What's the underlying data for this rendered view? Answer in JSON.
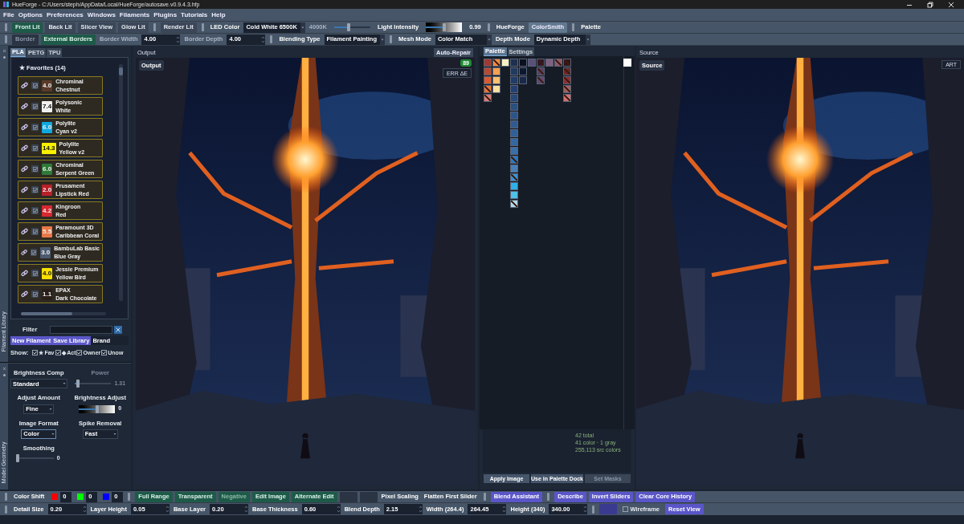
{
  "window": {
    "title": "HueForge - C:/Users/steph/AppData/Local/HueForge/autosave.v0.9.4.3.hfp"
  },
  "menu": [
    "File",
    "Options",
    "Preferences",
    "Windows",
    "Filaments",
    "Plugins",
    "Tutorials",
    "Help"
  ],
  "toolbars": [
    [
      {
        "kind": "sep"
      },
      {
        "kind": "green_button",
        "label": "Front Lit"
      },
      {
        "kind": "button",
        "label": "Back Lit"
      },
      {
        "kind": "button",
        "label": "Slicer View"
      },
      {
        "kind": "button",
        "label": "Glow Lit"
      },
      {
        "kind": "sep"
      },
      {
        "kind": "button",
        "label": "Render Lit"
      },
      {
        "kind": "sep"
      },
      {
        "kind": "label",
        "label": "LED Color"
      },
      {
        "kind": "select",
        "value": "Cold White 6500K"
      },
      {
        "kind": "label",
        "label": "4000K",
        "disabled": true
      },
      {
        "kind": "slider",
        "level": 0.4
      },
      {
        "kind": "label",
        "label": "Light Intensity"
      },
      {
        "kind": "gradient_slider",
        "level": 0.5
      },
      {
        "kind": "label",
        "label": "0.99"
      },
      {
        "kind": "sep"
      },
      {
        "kind": "label",
        "label": "HueForge"
      },
      {
        "kind": "light_button",
        "label": "ColorSmith"
      },
      {
        "kind": "sep"
      },
      {
        "kind": "label",
        "label": "Palette"
      }
    ],
    [
      {
        "kind": "sep"
      },
      {
        "kind": "button",
        "label": "Border",
        "disabled": true
      },
      {
        "kind": "green_button",
        "label": "External Borders"
      },
      {
        "kind": "label",
        "label": "Border Width",
        "disabled": true
      },
      {
        "kind": "spin",
        "value": "4.00"
      },
      {
        "kind": "label",
        "label": "Border Depth",
        "disabled": true
      },
      {
        "kind": "spin",
        "value": "4.00"
      },
      {
        "kind": "sep"
      },
      {
        "kind": "label",
        "label": "Blending Type"
      },
      {
        "kind": "select",
        "value": "Filament Painting"
      },
      {
        "kind": "sep"
      },
      {
        "kind": "label",
        "label": "Mesh Mode"
      },
      {
        "kind": "select",
        "value": "Color Match"
      },
      {
        "kind": "label",
        "label": "Depth Mode"
      },
      {
        "kind": "select",
        "value": "Dynamic Depth"
      }
    ]
  ],
  "filament_library": {
    "dock_label": "Filament Library",
    "tabs": [
      {
        "label": "PLA",
        "selected": true
      },
      {
        "label": "PETG",
        "selected": false
      },
      {
        "label": "TPU",
        "selected": false
      }
    ],
    "favorites_label": "★ Favorites (14)",
    "filaments": [
      {
        "value": "4.0",
        "brand": "Chrominal",
        "name": "Chestnut",
        "color": "#5a3a2a",
        "checked": true
      },
      {
        "value": "7.4",
        "brand": "Polysonic",
        "name": "White",
        "color": "#f0f0f0",
        "checked": true
      },
      {
        "value": "6.0",
        "brand": "Polylite",
        "name": "Cyan v2",
        "color": "#10a8e0",
        "checked": true
      },
      {
        "value": "14.3",
        "brand": "Polylite",
        "name": "Yellow v2",
        "color": "#f8f000",
        "checked": true
      },
      {
        "value": "6.0",
        "brand": "Chrominal",
        "name": "Serpent Green",
        "color": "#2e7a38",
        "checked": true
      },
      {
        "value": "2.0",
        "brand": "Prusament",
        "name": "Lipstick Red",
        "color": "#b8202a",
        "checked": true
      },
      {
        "value": "4.2",
        "brand": "Kingroon",
        "name": "Red",
        "color": "#d82830",
        "checked": true
      },
      {
        "value": "5.5",
        "brand": "Paramount 3D",
        "name": "Caribbean Coral",
        "color": "#e87848",
        "checked": true
      },
      {
        "value": "3.0",
        "brand": "BambuLab Basic",
        "name": "Blue Gray",
        "color": "#4a5a70",
        "checked": true
      },
      {
        "value": "4.0",
        "brand": "Jessie Premium",
        "name": "Yellow Bird",
        "color": "#f8e000",
        "checked": true
      },
      {
        "value": "1.1",
        "brand": "EPAX",
        "name": "Dark Chocolate",
        "color": "#2a1e1a",
        "checked": true
      }
    ],
    "filter_label": "Filter",
    "buttons": [
      "New Filament",
      "Save Library"
    ],
    "brand_label": "Brand",
    "show_label": "Show:",
    "show_options": [
      {
        "label": "★ Fav",
        "checked": true
      },
      {
        "label": "◆ Act",
        "checked": true
      },
      {
        "label": "Owner",
        "checked": true
      },
      {
        "label": "Unow",
        "checked": true
      }
    ]
  },
  "model_geometry": {
    "dock_label": "Model Geometry",
    "brightness_comp": {
      "label": "Brightness Comp",
      "value": "Standard"
    },
    "power": {
      "label": "Power",
      "level": 0.08,
      "reading": "1.31"
    },
    "adjust_amount": {
      "label": "Adjust Amount",
      "value": "Fine"
    },
    "brightness_adjust": {
      "label": "Brightness Adjust",
      "level": 0.5,
      "reading": "0"
    },
    "image_format": {
      "label": "Image Format",
      "value": "Color"
    },
    "spike_removal": {
      "label": "Spike Removal",
      "value": "Fast"
    },
    "smoothing": {
      "label": "Smoothing",
      "level": 0,
      "reading": "0"
    }
  },
  "output": {
    "title": "Output",
    "button": "Auto-Repair",
    "tag": "Output",
    "score": "89",
    "err_button": "ERR ΔE"
  },
  "palette": {
    "tabs": [
      {
        "label": "Palette",
        "selected": true
      },
      {
        "label": "Settings",
        "selected": false
      }
    ],
    "columns": [
      [
        {
          "color": "#a03a30",
          "hatched": false
        },
        {
          "color": "#b84a30",
          "hatched": false
        },
        {
          "color": "#d85a30",
          "hatched": false
        },
        {
          "color": "#e87030",
          "hatched": true
        },
        {
          "color": "#d87a70",
          "hatched": true
        }
      ],
      [
        {
          "color": "#f08a40",
          "hatched": true
        },
        {
          "color": "#f8a050",
          "hatched": false
        },
        {
          "color": "#f8c070",
          "hatched": false
        },
        {
          "color": "#f8e0a0",
          "hatched": false
        }
      ],
      [
        {
          "color": "#f8f0c0",
          "hatched": false
        }
      ],
      [
        {
          "color": "#1e3050",
          "hatched": false
        },
        {
          "color": "#203a60",
          "hatched": false
        },
        {
          "color": "#203c68",
          "hatched": false
        },
        {
          "color": "#244070",
          "hatched": false
        },
        {
          "color": "#284878",
          "hatched": false
        },
        {
          "color": "#2a5080",
          "hatched": false
        },
        {
          "color": "#2c5488",
          "hatched": false
        },
        {
          "color": "#305a90",
          "hatched": false
        },
        {
          "color": "#306098",
          "hatched": false
        },
        {
          "color": "#3468a0",
          "hatched": false
        },
        {
          "color": "#3a70a8",
          "hatched": false
        },
        {
          "color": "#2a78c0",
          "hatched": true
        },
        {
          "color": "#4a80b8",
          "hatched": false
        },
        {
          "color": "#3a90d0",
          "hatched": true
        },
        {
          "color": "#30b0e8",
          "hatched": false
        },
        {
          "color": "#50c0e8",
          "hatched": false
        },
        {
          "color": "#b0d8e8",
          "hatched": true
        }
      ],
      [
        {
          "color": "#0a1020",
          "hatched": false
        },
        {
          "color": "#0c1830",
          "hatched": false
        },
        {
          "color": "#1a2848",
          "hatched": false
        }
      ],
      [
        {
          "color": "#5a5078",
          "hatched": false
        }
      ],
      [
        {
          "color": "#301828",
          "hatched": true
        },
        {
          "color": "#584060",
          "hatched": true
        },
        {
          "color": "#604870",
          "hatched": true
        }
      ],
      [
        {
          "color": "#806080",
          "hatched": false
        }
      ],
      [
        {
          "color": "#905868",
          "hatched": true
        }
      ],
      [
        {
          "color": "#301418",
          "hatched": true
        },
        {
          "color": "#6a2828",
          "hatched": true
        },
        {
          "color": "#8a3030",
          "hatched": true
        },
        {
          "color": "#a06060",
          "hatched": true
        },
        {
          "color": "#d07070",
          "hatched": true
        }
      ]
    ],
    "side_swatch": {
      "color": "#ffffff"
    },
    "stats": [
      "42 total",
      "41 color · 1 gray",
      "255,113 src colors"
    ],
    "buttons": [
      {
        "label": "Apply Image",
        "disabled": false
      },
      {
        "label": "Use in Palette Dock",
        "disabled": false
      },
      {
        "label": "Set Masks",
        "disabled": true
      }
    ]
  },
  "source": {
    "title": "Source",
    "tag": "Source",
    "button": "ART"
  },
  "bottom_bars": [
    [
      {
        "kind": "sep"
      },
      {
        "kind": "label",
        "label": "Color Shift"
      },
      {
        "kind": "color",
        "color": "#ff0000"
      },
      {
        "kind": "spin",
        "value": "0"
      },
      {
        "kind": "color",
        "color": "#00ff00"
      },
      {
        "kind": "spin",
        "value": "0"
      },
      {
        "kind": "color",
        "color": "#0000ff"
      },
      {
        "kind": "spin",
        "value": "0"
      },
      {
        "kind": "sep"
      },
      {
        "kind": "green_button",
        "label": "Full Range"
      },
      {
        "kind": "green_button",
        "label": "Transparent"
      },
      {
        "kind": "green_button",
        "label": "Negative",
        "disabled": true
      },
      {
        "kind": "green_button",
        "label": "Edit Image"
      },
      {
        "kind": "green_button",
        "label": "Alternate Edit"
      },
      {
        "kind": "button",
        "disabled": true
      },
      {
        "kind": "button",
        "disabled": true
      },
      {
        "kind": "label",
        "label": "Pixel Scaling"
      },
      {
        "kind": "label",
        "label": "Flatten First Slider"
      },
      {
        "kind": "sep"
      },
      {
        "kind": "purple_button",
        "label": "Blend Assistant"
      },
      {
        "kind": "sep"
      },
      {
        "kind": "purple_button",
        "label": "Describe"
      },
      {
        "kind": "purple_button",
        "label": "Invert Sliders"
      },
      {
        "kind": "purple_button",
        "label": "Clear Core History"
      }
    ],
    [
      {
        "kind": "sep"
      },
      {
        "kind": "label",
        "label": "Detail Size"
      },
      {
        "kind": "spin",
        "value": "0.20"
      },
      {
        "kind": "label",
        "label": "Layer Height"
      },
      {
        "kind": "spin",
        "value": "0.05"
      },
      {
        "kind": "label",
        "label": "Base Layer"
      },
      {
        "kind": "spin",
        "value": "0.20"
      },
      {
        "kind": "label",
        "label": "Base Thickness"
      },
      {
        "kind": "spin",
        "value": "0.60"
      },
      {
        "kind": "label",
        "label": "Blend Depth"
      },
      {
        "kind": "spin",
        "value": "2.15"
      },
      {
        "kind": "label",
        "label": "Width (264.4)"
      },
      {
        "kind": "spin",
        "value": "264.45"
      },
      {
        "kind": "label",
        "label": "Height (340)"
      },
      {
        "kind": "spin",
        "value": "340.00"
      },
      {
        "kind": "sep"
      },
      {
        "kind": "purple_button",
        "disabled": true
      },
      {
        "kind": "checkbox",
        "label": "Wireframe",
        "checked": false
      },
      {
        "kind": "purple_button",
        "label": "Reset View"
      }
    ]
  ]
}
